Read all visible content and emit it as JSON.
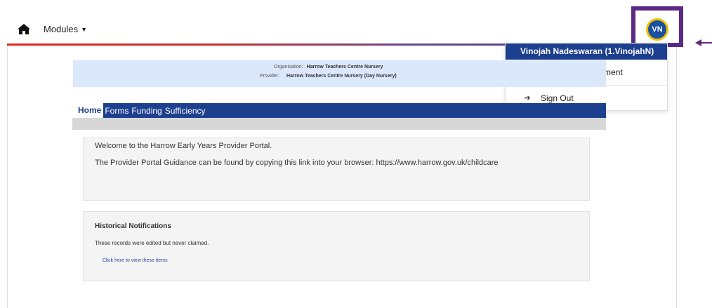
{
  "header": {
    "modules_label": "Modules",
    "avatar_initials": "VN"
  },
  "user_menu": {
    "user_name": "Vinojah Nadeswaran (1.VinojahN)",
    "items": [
      {
        "label": "Account Management",
        "icon": "user-icon"
      },
      {
        "label": "Sign Out",
        "icon": "sign-out-icon"
      }
    ]
  },
  "org_info": {
    "organisation_label": "Organisation:",
    "organisation_value": "Harrow Teachers Centre Nursery",
    "provider_label": "Provider:",
    "provider_value": "Harrow Teachers Centre Nursery (Day Nursery)"
  },
  "tabs": [
    {
      "label": "Home",
      "active": true
    },
    {
      "label": "Forms"
    },
    {
      "label": "Funding"
    },
    {
      "label": "Sufficiency"
    }
  ],
  "welcome": {
    "line1": "Welcome to the Harrow Early Years Provider Portal.",
    "line2": "The Provider Portal Guidance can be found by copying this link into your browser: https://www.harrow.gov.uk/childcare"
  },
  "notifications": {
    "title": "Historical Notifications",
    "text": "These records were edited but never claimed.",
    "link": "Click here to view these items"
  },
  "colors": {
    "nav_blue": "#1d3f8f",
    "highlight_purple": "#5b2a86",
    "avatar_ring": "#f2c200"
  }
}
